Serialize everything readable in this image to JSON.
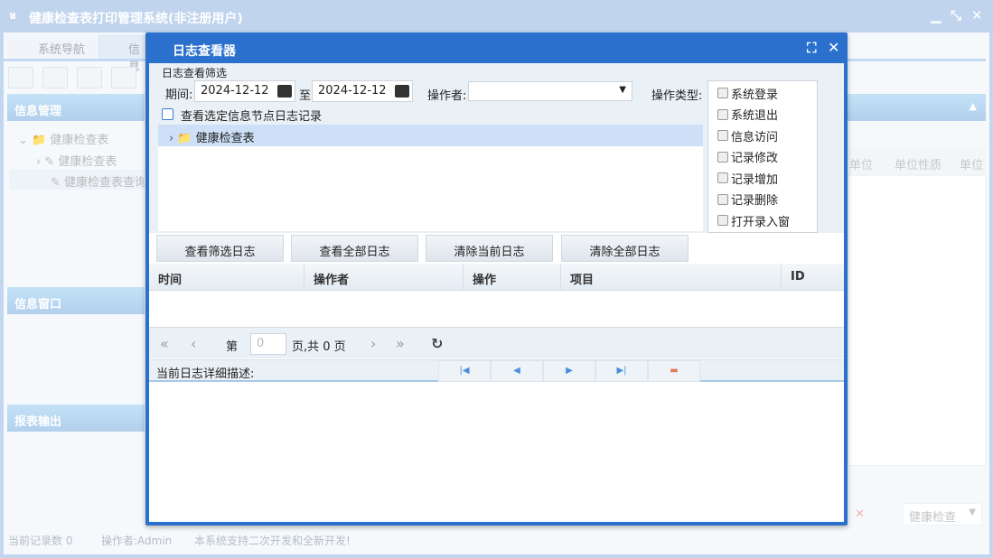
{
  "app": {
    "title": "健康检查表打印管理系统(非注册用户)",
    "logo": "ᴚ"
  },
  "tabs": [
    "系统导航",
    "信息"
  ],
  "left": {
    "panels": [
      "信息管理",
      "信息窗口",
      "报表输出"
    ],
    "tree": [
      "健康检查表",
      "健康检查表",
      "健康检查表查询"
    ]
  },
  "bg_columns": [
    "单位",
    "单位性质",
    "单位"
  ],
  "bg_select": "健康检查",
  "status": {
    "records": "当前记录数 0",
    "operator": "操作者:Admin",
    "note": "本系统支持二次开发和全新开发!"
  },
  "dialog": {
    "title": "日志查看器",
    "filter_title": "日志查看筛选",
    "period_label": "期间:",
    "date_from": "2024-12-12",
    "to_label": "至",
    "date_to": "2024-12-12",
    "operator_label": "操作者:",
    "operator_value": "",
    "optype_label": "操作类型:",
    "optypes": [
      "系统登录",
      "系统退出",
      "信息访问",
      "记录修改",
      "记录增加",
      "记录删除",
      "打开录入窗"
    ],
    "node_check_label": "查看选定信息节点日志记录",
    "tree_node": "健康检查表",
    "buttons": [
      "查看筛选日志",
      "查看全部日志",
      "清除当前日志",
      "清除全部日志"
    ],
    "columns": [
      "时间",
      "操作者",
      "操作",
      "项目",
      "ID"
    ],
    "pager": {
      "page_prefix": "第",
      "page_value": "0",
      "page_suffix": "页,共 0 页"
    },
    "detail_label": "当前日志详细描述:"
  }
}
